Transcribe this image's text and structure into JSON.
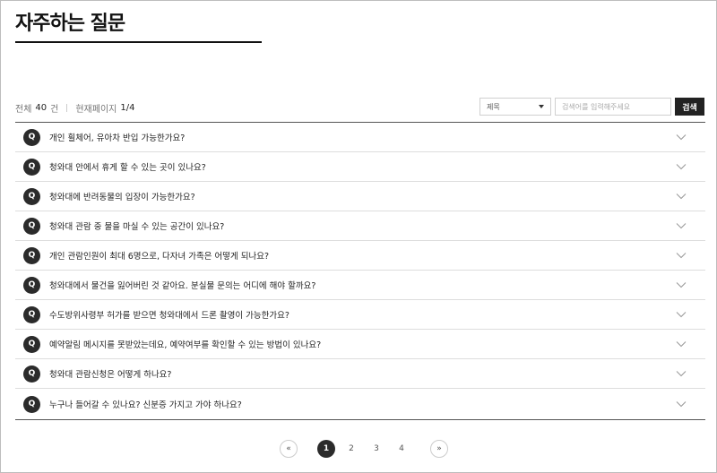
{
  "page": {
    "title": "자주하는 질문"
  },
  "summary": {
    "total_label": "전체",
    "total_count": "40",
    "total_unit": "건",
    "current_page_label": "현재페이지",
    "current_page": "1/4"
  },
  "search": {
    "select_value": "제목",
    "input_placeholder": "검색어를 입력해주세요",
    "button_label": "검색"
  },
  "faq": {
    "badge": "Q",
    "items": [
      {
        "question": "개인 휠체어, 유아차 반입 가능한가요?"
      },
      {
        "question": "청와대 안에서 휴게 할 수 있는 곳이 있나요?"
      },
      {
        "question": "청와대에 반려동물의 입장이 가능한가요?"
      },
      {
        "question": "청와대 관람 중 물을 마실 수 있는 공간이 있나요?"
      },
      {
        "question": "개인 관람인원이 최대 6명으로, 다자녀 가족은 어떻게 되나요?"
      },
      {
        "question": "청와대에서 물건을 잃어버린 것 같아요. 분실물 문의는 어디에 해야 할까요?"
      },
      {
        "question": "수도방위사령부 허가를 받으면 청와대에서 드론 촬영이 가능한가요?"
      },
      {
        "question": "예약알림 메시지를 못받았는데요, 예약여부를 확인할 수 있는 방법이 있나요?"
      },
      {
        "question": "청와대 관람신청은 어떻게 하나요?"
      },
      {
        "question": "누구나 들어갈 수 있나요? 신분증 가지고 가야 하나요?"
      }
    ]
  },
  "pagination": {
    "prev": "«",
    "next": "»",
    "pages": [
      "1",
      "2",
      "3",
      "4"
    ],
    "active": "1"
  },
  "colors": {
    "badge": "#2b2b2b",
    "search_button": "#222222"
  }
}
